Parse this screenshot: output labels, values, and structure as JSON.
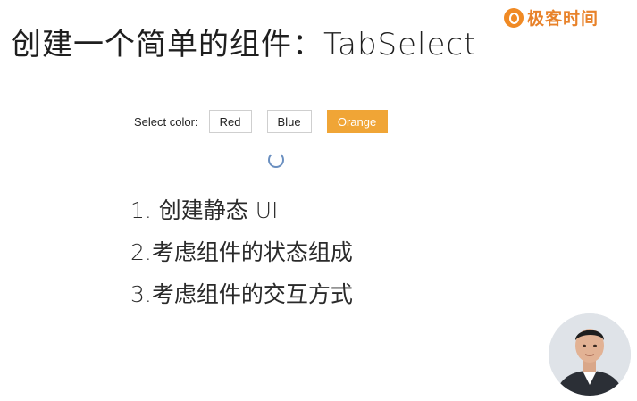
{
  "header": {
    "title": "创建一个简单的组件：TabSelect",
    "logo_text": "极客时间",
    "logo_color": "#e8822a"
  },
  "demo": {
    "label": "Select color:",
    "options": [
      "Red",
      "Blue",
      "Orange"
    ],
    "selected": "Orange",
    "selected_color": "#f0a536"
  },
  "steps": [
    "1. 创建静态 UI",
    "2.考虑组件的状态组成",
    "3.考虑组件的交互方式"
  ]
}
